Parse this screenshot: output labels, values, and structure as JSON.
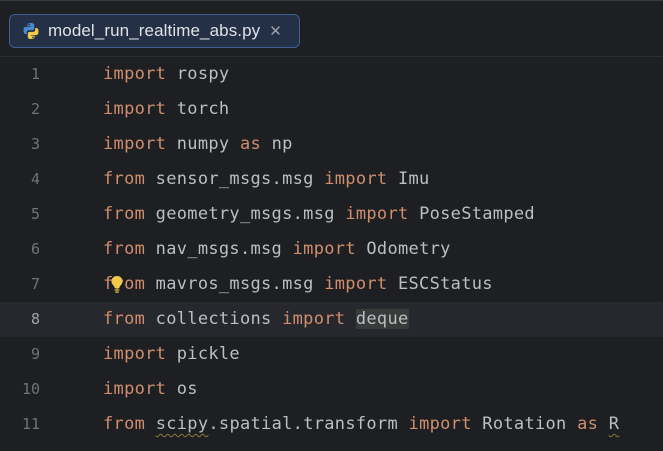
{
  "tab": {
    "filename": "model_run_realtime_abs.py",
    "icon": "python-icon",
    "close_glyph": "✕"
  },
  "editor": {
    "current_line": 8,
    "lines": [
      {
        "num": "1",
        "parts": [
          {
            "t": "import",
            "k": "kw"
          },
          {
            "t": " rospy"
          }
        ]
      },
      {
        "num": "2",
        "parts": [
          {
            "t": "import",
            "k": "kw"
          },
          {
            "t": " torch"
          }
        ]
      },
      {
        "num": "3",
        "parts": [
          {
            "t": "import",
            "k": "kw"
          },
          {
            "t": " numpy "
          },
          {
            "t": "as",
            "k": "kw"
          },
          {
            "t": " np"
          }
        ]
      },
      {
        "num": "4",
        "parts": [
          {
            "t": "from",
            "k": "kw"
          },
          {
            "t": " sensor_msgs.msg "
          },
          {
            "t": "import",
            "k": "kw"
          },
          {
            "t": " Imu"
          }
        ]
      },
      {
        "num": "5",
        "parts": [
          {
            "t": "from",
            "k": "kw"
          },
          {
            "t": " geometry_msgs.msg "
          },
          {
            "t": "import",
            "k": "kw"
          },
          {
            "t": " PoseStamped"
          }
        ]
      },
      {
        "num": "6",
        "parts": [
          {
            "t": "from",
            "k": "kw"
          },
          {
            "t": " nav_msgs.msg "
          },
          {
            "t": "import",
            "k": "kw"
          },
          {
            "t": " Odometry"
          }
        ]
      },
      {
        "num": "7",
        "parts": [
          {
            "t": "from",
            "k": "kw"
          },
          {
            "t": " mavros_msgs.msg "
          },
          {
            "t": "import",
            "k": "kw"
          },
          {
            "t": " ESCStatus"
          }
        ],
        "bulb": true
      },
      {
        "num": "8",
        "parts": [
          {
            "t": "from",
            "k": "kw"
          },
          {
            "t": " collections "
          },
          {
            "t": "import",
            "k": "kw"
          },
          {
            "t": " "
          },
          {
            "t": "deque",
            "k": "hl"
          }
        ]
      },
      {
        "num": "9",
        "parts": [
          {
            "t": "import",
            "k": "kw"
          },
          {
            "t": " pickle"
          }
        ]
      },
      {
        "num": "10",
        "parts": [
          {
            "t": "import",
            "k": "kw"
          },
          {
            "t": " os"
          }
        ]
      },
      {
        "num": "11",
        "parts": [
          {
            "t": "from",
            "k": "kw"
          },
          {
            "t": " "
          },
          {
            "t": "scipy",
            "k": "squiggle"
          },
          {
            "t": ".spatial.transform "
          },
          {
            "t": "import",
            "k": "kw"
          },
          {
            "t": " Rotation "
          },
          {
            "t": "as",
            "k": "kw"
          },
          {
            "t": " "
          },
          {
            "t": "R",
            "k": "squiggle"
          }
        ]
      }
    ]
  },
  "colors": {
    "background": "#1e1f22",
    "keyword": "#cf8e6d",
    "text": "#bcbec4",
    "line_number": "#6f737a",
    "current_line": "#26282e",
    "tab_border": "#3f5f95"
  }
}
